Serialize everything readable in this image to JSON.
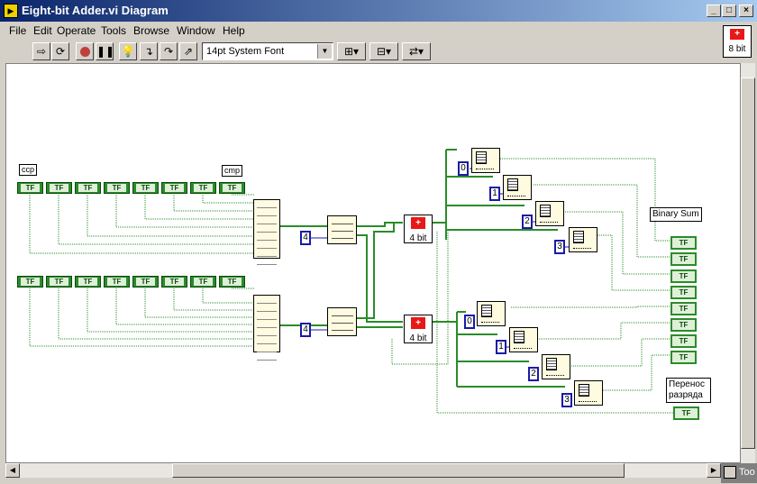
{
  "window": {
    "title": "Eight-bit Adder.vi Diagram",
    "minimize": "_",
    "maximize": "□",
    "close": "×"
  },
  "menu": [
    "File",
    "Edit",
    "Operate",
    "Tools",
    "Browse",
    "Window",
    "Help"
  ],
  "toolbar": {
    "font": "14pt System Font"
  },
  "vi_icon": {
    "label": "8 bit",
    "glyph": "+"
  },
  "diagram": {
    "top_label_left": "ccp",
    "top_label_right": "cmp",
    "bool_text": "TF",
    "const_a": "4",
    "const_b": "4",
    "adder_label": "4 bit",
    "adder_glyph": "+",
    "index_upper": [
      "0",
      "1",
      "2",
      "3"
    ],
    "index_lower": [
      "0",
      "1",
      "2",
      "3"
    ],
    "binary_sum": "Binary Sum",
    "carry_label": "Перенос разряда"
  },
  "statusbar": {
    "tools": "Too"
  }
}
